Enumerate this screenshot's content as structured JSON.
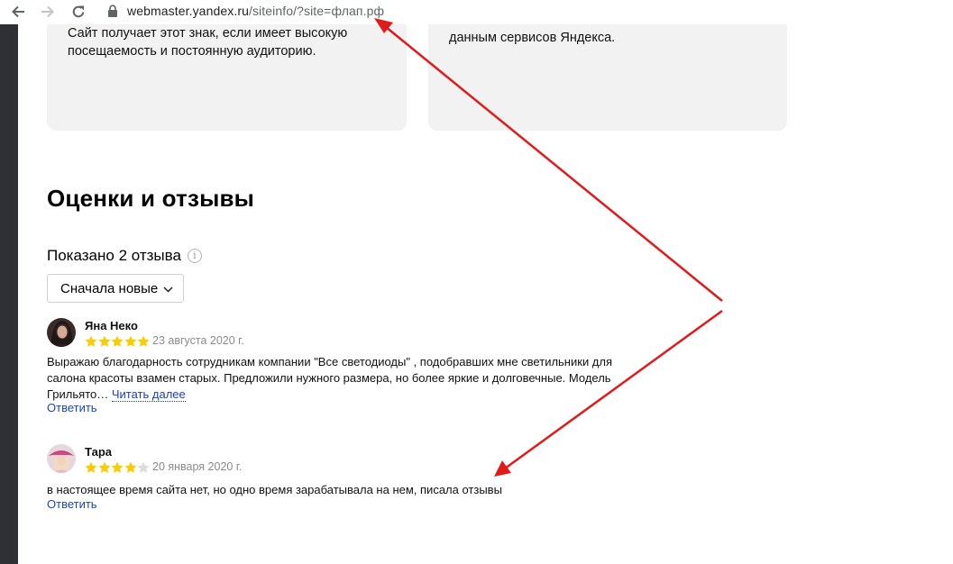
{
  "browser": {
    "url_host": "webmaster.yandex.ru",
    "url_path": "/siteinfo/?site=флап.рф",
    "icons": [
      "back-arrow-icon",
      "forward-arrow-icon",
      "reload-icon",
      "lock-icon"
    ]
  },
  "cards": {
    "left_text": "Сайт получает этот знак, если имеет высокую посещаемость и постоянную аудиторию.",
    "right_text": "данным сервисов Яндекса."
  },
  "reviews_section": {
    "title": "Оценки и отзывы",
    "count_label": "Показано 2 отзыва",
    "info_icon_glyph": "i",
    "sort_label": "Сначала новые"
  },
  "reviews": [
    {
      "author": "Яна Неко",
      "rating": 5,
      "date": "23 августа 2020 г.",
      "text": "Выражаю благодарность сотрудникам компании \"Все светодиоды\" , подобравших мне светильники для салона красоты взамен старых. Предложили нужного размера, но более яркие и долговечные. Модель Грильято…",
      "read_more": "Читать далее",
      "reply": "Ответить"
    },
    {
      "author": "Тара",
      "rating": 4,
      "date": "20 января 2020 г.",
      "text": "в настоящее время сайта нет, но одно время зарабатывала на нем, писала отзывы",
      "reply": "Ответить"
    }
  ],
  "colors": {
    "star_filled": "#fccb00",
    "star_empty": "#dcdcdc",
    "link": "#1a47b8",
    "annotation_arrow": "#e01b1b",
    "card_bg": "#f2f2f2"
  }
}
